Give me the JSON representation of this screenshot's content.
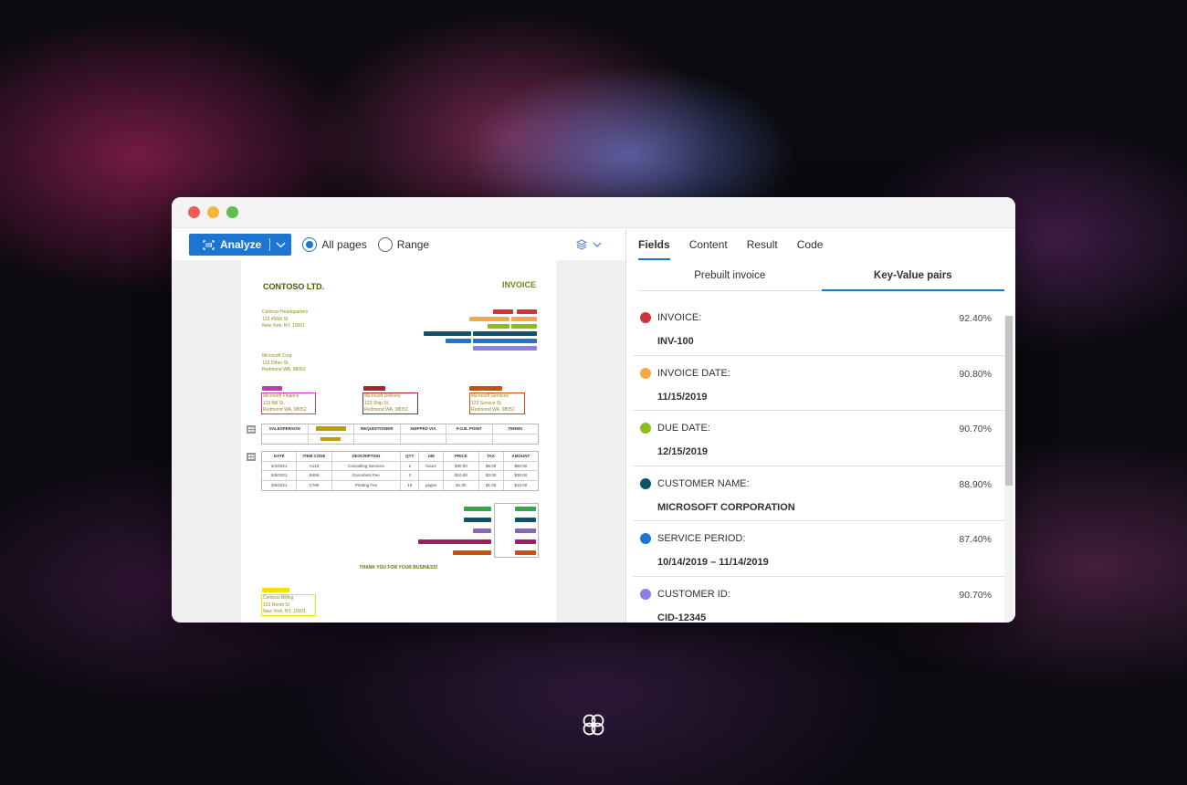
{
  "toolbar": {
    "analyze_label": "Analyze",
    "radio_all_pages": "All pages",
    "radio_range": "Range",
    "selected_radio": "All pages"
  },
  "document": {
    "company": "CONTOSO LTD.",
    "title": "INVOICE",
    "hq_address": [
      "Contoso Headquarters",
      "123 456th St",
      "New York, NY, 10001"
    ],
    "customer_address": [
      "Microsoft Corp",
      "123 Other St,",
      "Redmond WA, 98052"
    ],
    "billing_address": [
      "Microsoft Finance",
      "123 Bill St,",
      "Redmond WA, 98052"
    ],
    "shipping_address": [
      "Microsoft Delivery",
      "123 Ship St,",
      "Redmond WA, 98052"
    ],
    "service_address": [
      "Microsoft Services",
      "123 Service St,",
      "Redmond WA, 98052"
    ],
    "remit_address": [
      "Contoso Billing",
      "123 Remit St",
      "New York, NY, 10001"
    ],
    "sales_table_headers": [
      "SALESPERSON",
      "P.O. NUMBER",
      "REQUISITIONER",
      "SHIPPED VIA",
      "F.O.B. POINT",
      "TERMS"
    ],
    "items_table_headers": [
      "DATE",
      "ITEM CODE",
      "DESCRIPTION",
      "QTY",
      "UM",
      "PRICE",
      "TAX",
      "AMOUNT"
    ],
    "items_rows": [
      [
        "3/4/2021",
        "A123",
        "Consulting Services",
        "2",
        "hours",
        "$30.00",
        "$6.00",
        "$60.00"
      ],
      [
        "3/5/2021",
        "B456",
        "Document Fee",
        "3",
        "",
        "$10.00",
        "$3.00",
        "$30.00"
      ],
      [
        "3/6/2021",
        "C789",
        "Printing Fee",
        "10",
        "pages",
        "$1.00",
        "$1.00",
        "$10.00"
      ]
    ],
    "thanks": "THANK YOU FOR YOUR BUSINESS!"
  },
  "panel": {
    "tabs": [
      "Fields",
      "Content",
      "Result",
      "Code"
    ],
    "active_tab": "Fields",
    "pivots": [
      "Prebuilt invoice",
      "Key-Value pairs"
    ],
    "active_pivot": "Key-Value pairs",
    "fields": [
      {
        "key": "INVOICE:",
        "confidence": "92.40%",
        "value": "INV-100",
        "color": "#d13438"
      },
      {
        "key": "INVOICE DATE:",
        "confidence": "90.80%",
        "value": "11/15/2019",
        "color": "#f7a844"
      },
      {
        "key": "DUE DATE:",
        "confidence": "90.70%",
        "value": "12/15/2019",
        "color": "#8cbd18"
      },
      {
        "key": "CUSTOMER NAME:",
        "confidence": "88.90%",
        "value": "MICROSOFT CORPORATION",
        "color": "#0b556a"
      },
      {
        "key": "SERVICE PERIOD:",
        "confidence": "87.40%",
        "value": "10/14/2019 – 11/14/2019",
        "color": "#1b76d2"
      },
      {
        "key": "CUSTOMER ID:",
        "confidence": "90.70%",
        "value": "CID-12345",
        "color": "#8f7ee7"
      }
    ]
  }
}
